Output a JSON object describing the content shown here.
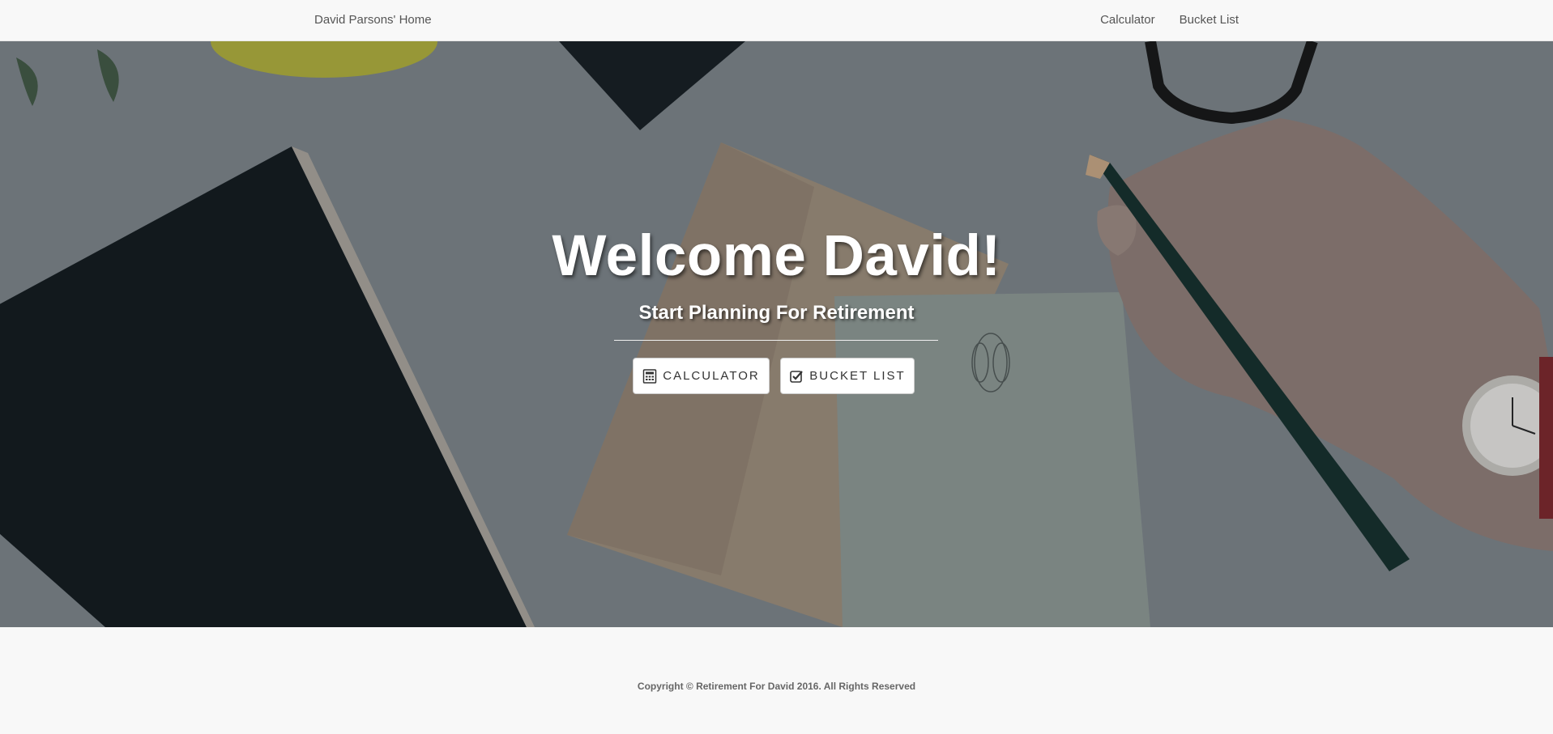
{
  "navbar": {
    "brand": "David Parsons' Home",
    "links": [
      {
        "label": "Calculator"
      },
      {
        "label": "Bucket List"
      }
    ]
  },
  "hero": {
    "title": "Welcome David!",
    "subtitle": "Start Planning For Retirement",
    "buttons": [
      {
        "label": "CALCULATOR",
        "icon": "calculator-icon"
      },
      {
        "label": "BUCKET LIST",
        "icon": "check-square-icon"
      }
    ]
  },
  "footer": {
    "copyright": "Copyright © Retirement For David 2016. All Rights Reserved"
  },
  "colors": {
    "navbar_bg": "#f8f8f8",
    "hero_overlay": "#6f787d",
    "button_bg": "#ffffff",
    "text_dark": "#555555"
  }
}
